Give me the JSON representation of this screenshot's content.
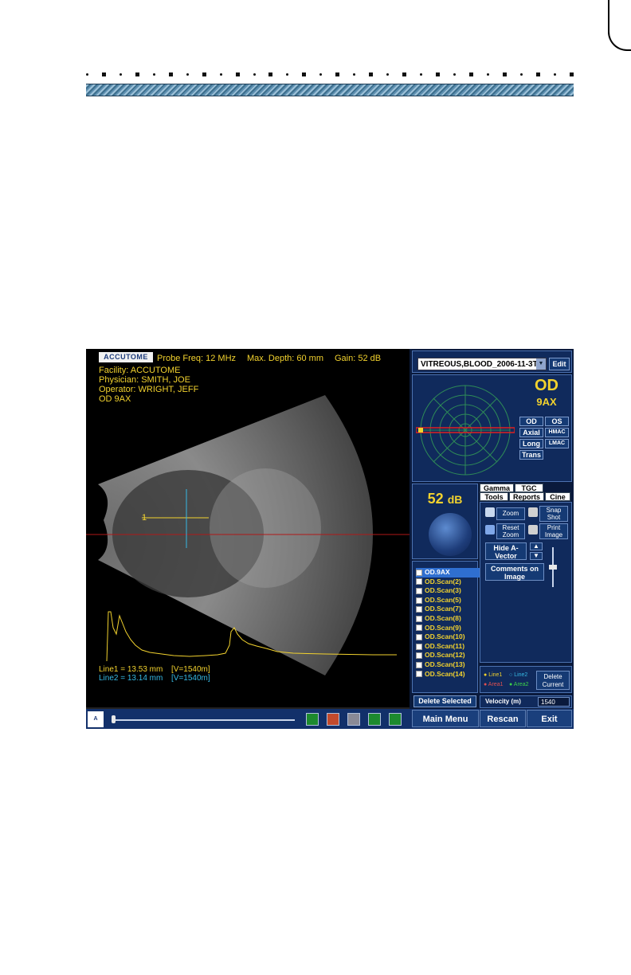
{
  "overlay": {
    "logo": "ACCUTOME",
    "probe_freq": "Probe Freq: 12 MHz",
    "max_depth": "Max. Depth: 60 mm",
    "gain": "Gain: 52 dB",
    "facility": "Facility: ACCUTOME",
    "physician": "Physician: SMITH, JOE",
    "operator": "Operator: WRIGHT, JEFF",
    "view": "OD  9AX",
    "marker": "1",
    "line1_value": "Line1 = 13.53 mm",
    "line1_velocity": "[V=1540m]",
    "line2_value": "Line2 = 13.14 mm",
    "line2_velocity": "[V=1540m]"
  },
  "diagnosis": {
    "selected": "VITREOUS,BLOOD_2006-11-3T8",
    "edit": "Edit"
  },
  "eye": {
    "side": "OD",
    "view": "9AX",
    "buttons": [
      "OD",
      "OS",
      "Axial",
      "HMAC",
      "Long",
      "LMAC",
      "Trans"
    ]
  },
  "gain_panel": {
    "value": "52",
    "unit": "dB"
  },
  "tabs": {
    "row1": [
      "Gamma",
      "TGC"
    ],
    "row2": [
      "Tools",
      "Reports",
      "Cine"
    ]
  },
  "tools": {
    "zoom": "Zoom",
    "snap_shot": "Snap Shot",
    "reset_zoom": "Reset Zoom",
    "print_image": "Print Image",
    "hide_avector": "Hide A-Vector",
    "comments": "Comments on Image"
  },
  "scans": [
    "OD.9AX",
    "OD.Scan(2)",
    "OD.Scan(3)",
    "OD.Scan(5)",
    "OD.Scan(7)",
    "OD.Scan(8)",
    "OD.Scan(9)",
    "OD.Scan(10)",
    "OD.Scan(11)",
    "OD.Scan(12)",
    "OD.Scan(13)",
    "OD.Scan(14)"
  ],
  "delete_selected": "Delete Selected",
  "measure": {
    "line1": "Line1",
    "line2": "Line2",
    "area1": "Area1",
    "area2": "Area2",
    "delete_current": "Delete Current",
    "velocity_label": "Velocity (m)",
    "velocity_value": "1540"
  },
  "nav": {
    "main_menu": "Main Menu",
    "rescan": "Rescan",
    "exit": "Exit"
  },
  "colors": {
    "overlay_yellow": "#f2d22e",
    "line2_cyan": "#36b9e3",
    "panel_blue": "#102a5c"
  }
}
